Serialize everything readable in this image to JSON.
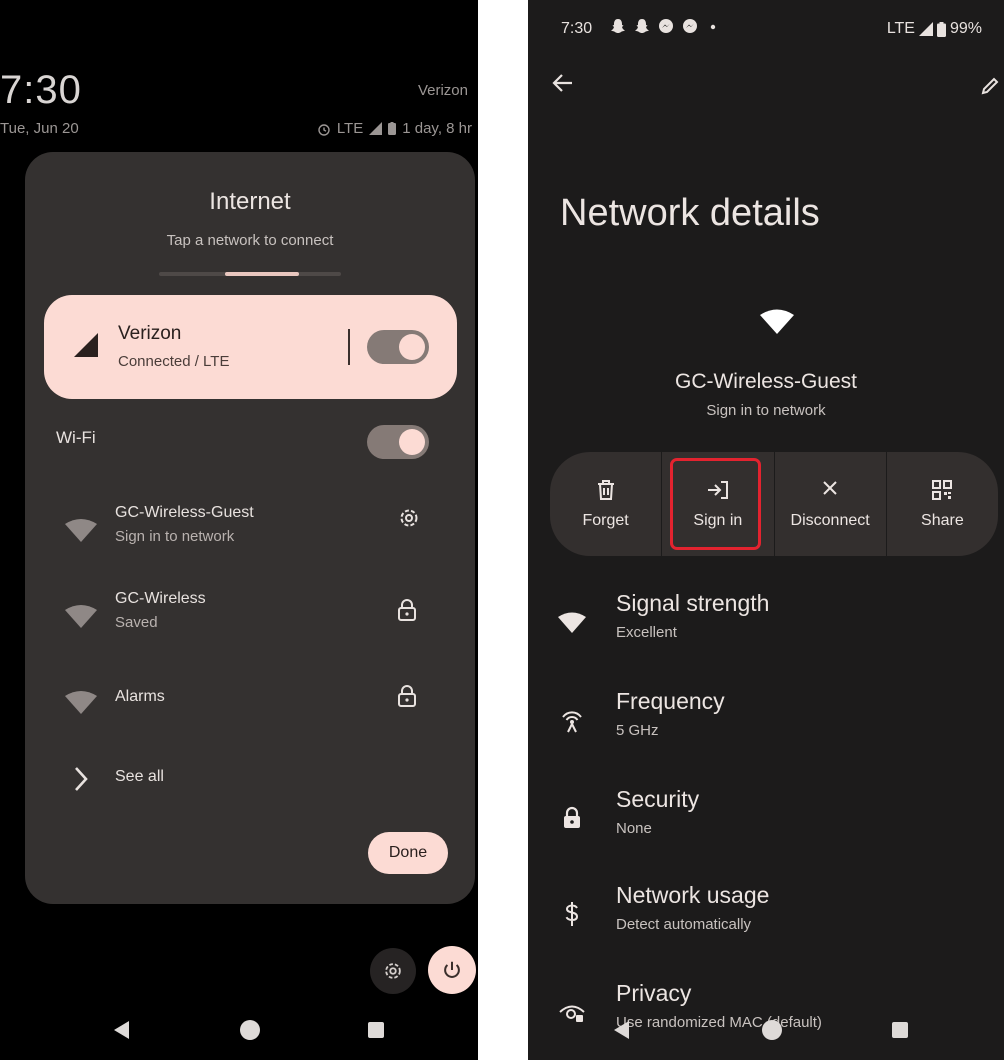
{
  "left": {
    "lockscreen": {
      "time": "7:30",
      "carrier": "Verizon",
      "date": "Tue, Jun 20",
      "network_type": "LTE",
      "battery_text": "1 day, 8 hr"
    },
    "internet_panel": {
      "title": "Internet",
      "subtitle": "Tap a network to connect",
      "carrier_card": {
        "name": "Verizon",
        "status": "Connected / LTE",
        "toggle_on": true
      },
      "wifi_label": "Wi-Fi",
      "wifi_toggle_on": true,
      "networks": [
        {
          "name": "GC-Wireless-Guest",
          "status": "Sign in to network",
          "action_icon": "gear-icon"
        },
        {
          "name": "GC-Wireless",
          "status": "Saved",
          "action_icon": "lock-icon"
        },
        {
          "name": "Alarms",
          "status": "",
          "action_icon": "lock-icon"
        }
      ],
      "see_all": "See all",
      "done": "Done"
    }
  },
  "right": {
    "status_bar": {
      "time": "7:30",
      "network_type": "LTE",
      "battery": "99%"
    },
    "title": "Network details",
    "ssid": "GC-Wireless-Guest",
    "ssid_status": "Sign in to network",
    "actions": [
      {
        "label": "Forget",
        "icon": "trash-icon"
      },
      {
        "label": "Sign in",
        "icon": "sign-in-icon"
      },
      {
        "label": "Disconnect",
        "icon": "close-icon"
      },
      {
        "label": "Share",
        "icon": "qr-code-icon"
      }
    ],
    "details": [
      {
        "title": "Signal strength",
        "value": "Excellent",
        "icon": "wifi-icon"
      },
      {
        "title": "Frequency",
        "value": "5 GHz",
        "icon": "antenna-icon"
      },
      {
        "title": "Security",
        "value": "None",
        "icon": "lock-icon"
      },
      {
        "title": "Network usage",
        "value": "Detect automatically",
        "icon": "dollar-icon"
      },
      {
        "title": "Privacy",
        "value": "Use randomized MAC (default)",
        "icon": "privacy-icon"
      }
    ]
  },
  "colors": {
    "accent": "#fcdbd4",
    "panel_bg": "#343130",
    "highlight": "#e3232f"
  }
}
